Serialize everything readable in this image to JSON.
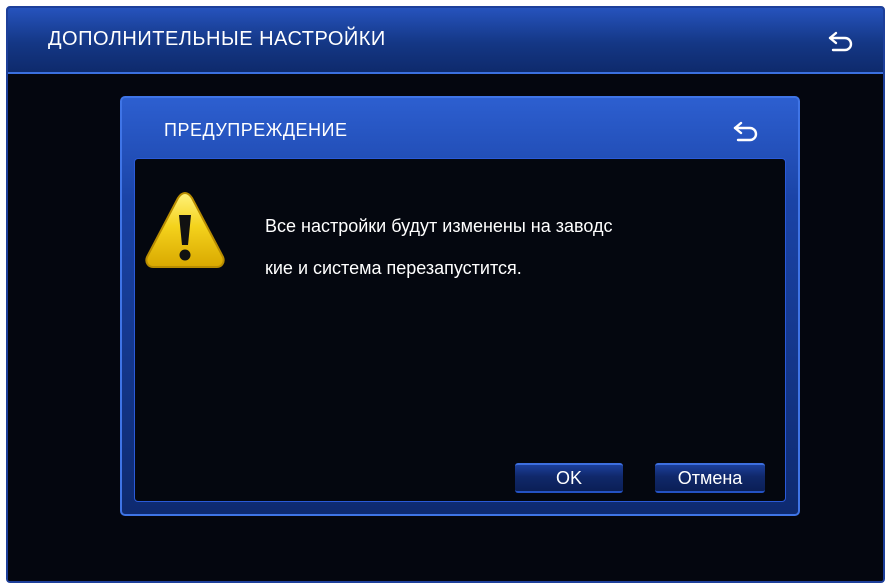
{
  "window": {
    "title": "ДОПОЛНИТЕЛЬНЫЕ НАСТРОЙКИ",
    "back_icon": "return-arrow-icon"
  },
  "dialog": {
    "title": "ПРЕДУПРЕЖДЕНИЕ",
    "back_icon": "return-arrow-icon",
    "icon": "warning-triangle-icon",
    "message_lines": [
      "Все настройки будут изменены на заводс",
      "кие и система перезапустится."
    ],
    "ok_label": "OK",
    "cancel_label": "Отмена"
  },
  "colors": {
    "header_blue": "#1a43a6",
    "border_blue": "#3f74e6",
    "background": "#04060f",
    "text": "#ffffff",
    "warning_yellow": "#f4d21c"
  }
}
